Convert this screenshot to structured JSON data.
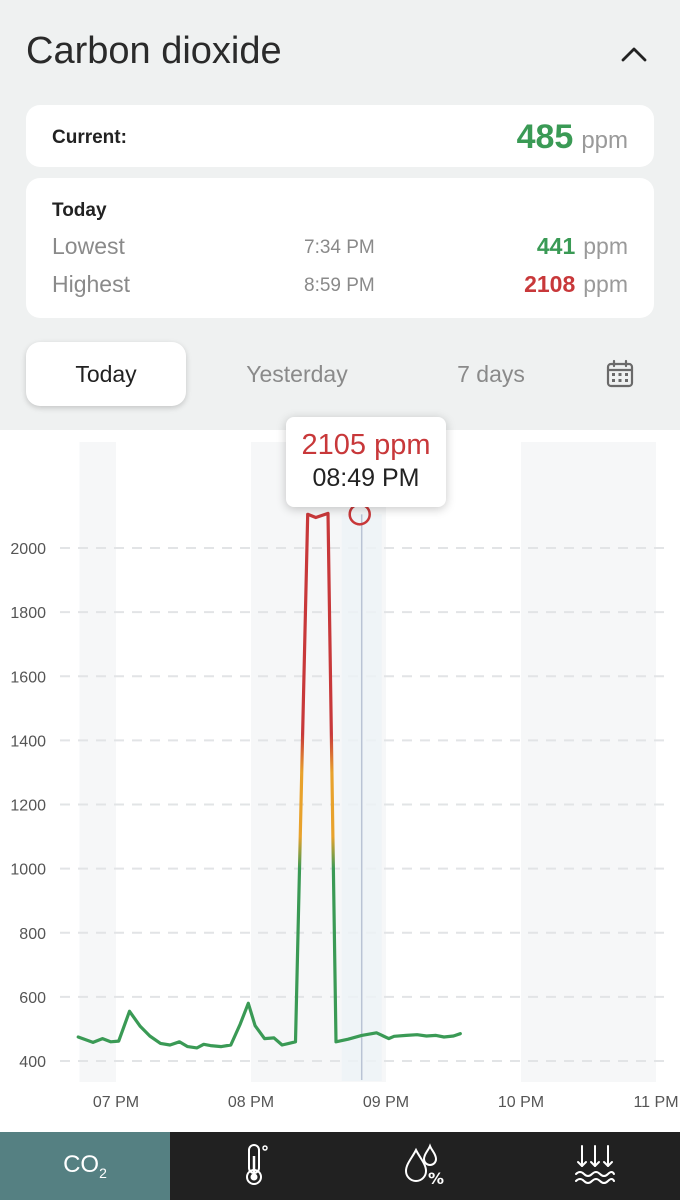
{
  "header": {
    "title": "Carbon dioxide",
    "collapse_icon": "chevron-up-icon"
  },
  "current": {
    "label": "Current:",
    "value": "485",
    "unit": "ppm",
    "value_color": "#3a9a55"
  },
  "today": {
    "heading": "Today",
    "lowest": {
      "label": "Lowest",
      "time": "7:34 PM",
      "value": "441",
      "unit": "ppm",
      "color": "#3a9a55"
    },
    "highest": {
      "label": "Highest",
      "time": "8:59 PM",
      "value": "2108",
      "unit": "ppm",
      "color": "#c8383a"
    }
  },
  "tabs": [
    {
      "label": "Today",
      "active": true
    },
    {
      "label": "Yesterday",
      "active": false
    },
    {
      "label": "7 days",
      "active": false
    }
  ],
  "calendar_icon": "calendar-icon",
  "tooltip": {
    "value": "2105 ppm",
    "time": "08:49 PM"
  },
  "chart_data": {
    "type": "line",
    "ylim": [
      400,
      2000
    ],
    "y_ticks": [
      400,
      600,
      800,
      1000,
      1200,
      1400,
      1600,
      1800,
      2000
    ],
    "y_tick_labels": [
      "400",
      "600",
      "800",
      "1000",
      "1200",
      "1400",
      "1600",
      "1800",
      "2000"
    ],
    "x_tick_labels": [
      "07 PM",
      "08 PM",
      "09 PM",
      "10 PM",
      "11 PM"
    ],
    "x_ticks_hours": [
      19,
      20,
      21,
      22,
      23
    ],
    "series": [
      {
        "x_hours": [
          18.72,
          18.83,
          18.9,
          18.96,
          19.02,
          19.1,
          19.18,
          19.25,
          19.33,
          19.4,
          19.47,
          19.53,
          19.6,
          19.65,
          19.7,
          19.78,
          19.85,
          19.92,
          19.98,
          20.03,
          20.1,
          20.17,
          20.23,
          20.28,
          20.33,
          20.42,
          20.48,
          20.57,
          20.63,
          20.72,
          20.82,
          20.93,
          21.02,
          21.06,
          21.15,
          21.23,
          21.3,
          21.37,
          21.43,
          21.5,
          21.55
        ],
        "values": [
          475,
          458,
          470,
          460,
          462,
          555,
          508,
          478,
          455,
          450,
          460,
          445,
          441,
          452,
          448,
          445,
          450,
          515,
          580,
          510,
          470,
          472,
          450,
          455,
          460,
          2105,
          2095,
          2108,
          460,
          468,
          480,
          488,
          470,
          477,
          480,
          482,
          478,
          480,
          475,
          478,
          485
        ],
        "threshold_colors": {
          "good": "#3a9a55",
          "moderate": "#e8a22c",
          "bad": "#c8383a"
        }
      }
    ],
    "highlight": {
      "x_hours": 20.82,
      "value": 2105
    }
  },
  "bottom_nav": [
    {
      "label": "CO",
      "sub": "2",
      "name": "co2",
      "active": true
    },
    {
      "icon": "thermometer-icon",
      "name": "temperature",
      "active": false
    },
    {
      "icon": "humidity-icon",
      "name": "humidity",
      "active": false
    },
    {
      "icon": "pressure-icon",
      "name": "pressure",
      "active": false
    }
  ]
}
